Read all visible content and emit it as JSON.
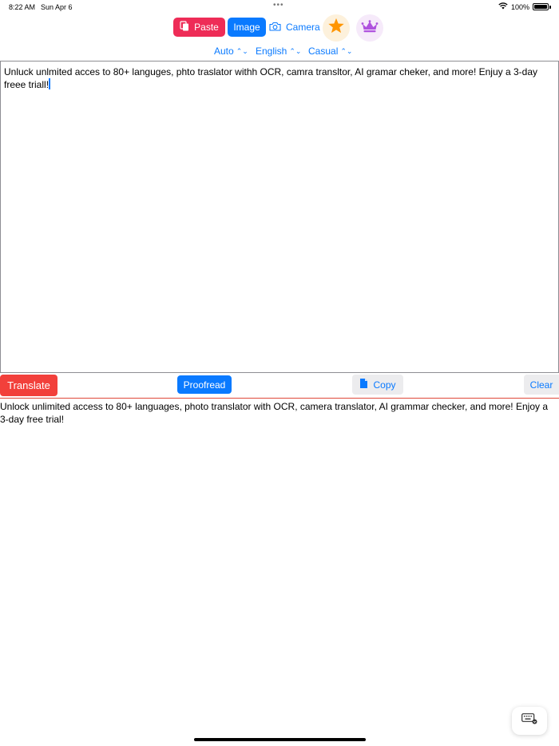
{
  "status_bar": {
    "time": "8:22 AM",
    "date": "Sun Apr 6",
    "dots": "•••",
    "battery_text": "100%",
    "battery_level": 1.0
  },
  "toolbar": {
    "paste_label": "Paste",
    "image_label": "Image",
    "camera_label": "Camera",
    "star_icon": "star-icon",
    "crown_icon": "crown-icon"
  },
  "selectors": {
    "source_language": "Auto",
    "target_language": "English",
    "tone": "Casual"
  },
  "input": {
    "text": "Unluck unlmited acces to 80+ languges, phto traslator withh OCR, camra transltor, AI gramar cheker, and more! Enjuy a 3-day freee triall!"
  },
  "actions": {
    "translate_label": "Translate",
    "proofread_label": "Proofread",
    "copy_label": "Copy",
    "clear_label": "Clear"
  },
  "output": {
    "text": "Unlock unlimited access to 80+ languages, photo translator with OCR, camera translator, AI grammar checker, and more! Enjoy a 3-day free trial!"
  },
  "colors": {
    "paste": "#ee2c57",
    "accent_blue": "#0a7aff",
    "translate": "#f2403b",
    "star": "#ff9500",
    "crown": "#af52de"
  }
}
